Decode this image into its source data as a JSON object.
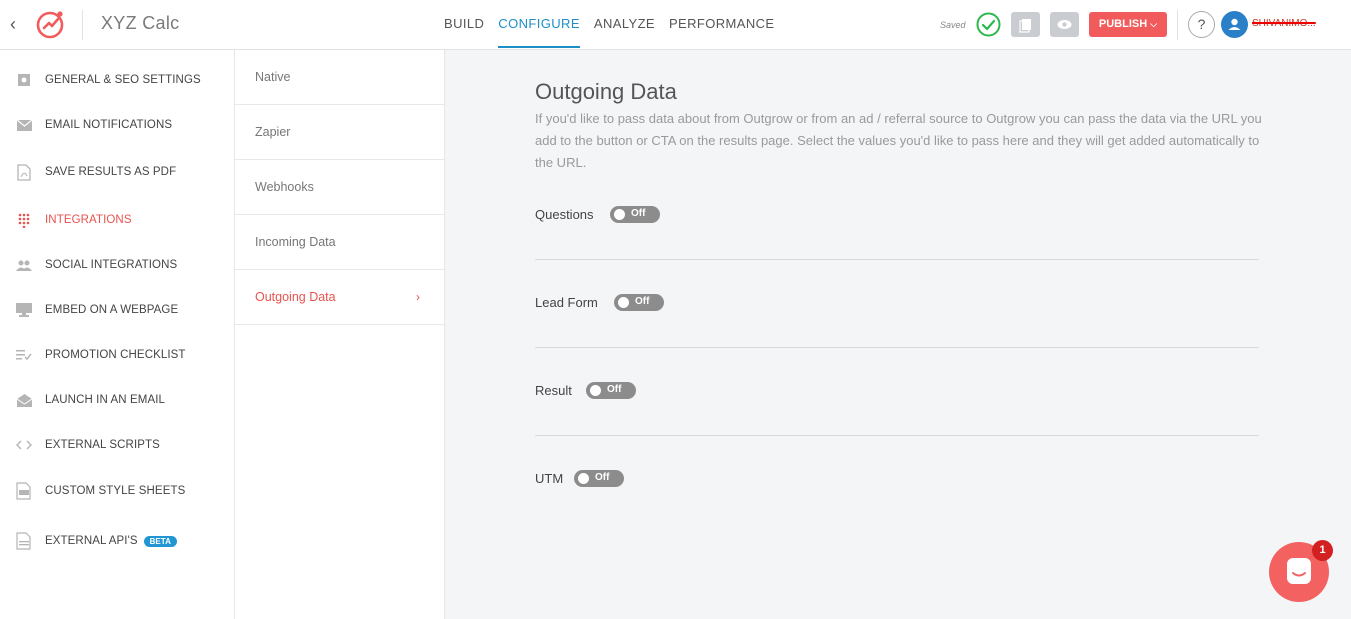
{
  "header": {
    "app_title": "XYZ Calc",
    "nav": [
      {
        "label": "BUILD"
      },
      {
        "label": "CONFIGURE",
        "active": true
      },
      {
        "label": "ANALYZE"
      },
      {
        "label": "PERFORMANCE"
      }
    ],
    "saved_label": "Saved",
    "publish_label": "PUBLISH",
    "help_label": "?",
    "username": "SHIVANIMO..."
  },
  "sidebar": {
    "items": [
      {
        "label": "GENERAL & SEO SETTINGS",
        "icon": "settings-icon"
      },
      {
        "label": "EMAIL NOTIFICATIONS",
        "icon": "envelope-icon"
      },
      {
        "label": "SAVE RESULTS AS PDF",
        "icon": "pdf-icon"
      },
      {
        "label": "INTEGRATIONS",
        "icon": "integrations-icon",
        "active": true
      },
      {
        "label": "SOCIAL INTEGRATIONS",
        "icon": "people-icon"
      },
      {
        "label": "EMBED ON A WEBPAGE",
        "icon": "monitor-icon"
      },
      {
        "label": "PROMOTION CHECKLIST",
        "icon": "checklist-icon"
      },
      {
        "label": "LAUNCH IN AN EMAIL",
        "icon": "open-envelope-icon"
      },
      {
        "label": "EXTERNAL SCRIPTS",
        "icon": "code-icon"
      },
      {
        "label": "CUSTOM STYLE SHEETS",
        "icon": "css-file-icon"
      },
      {
        "label": "EXTERNAL API'S",
        "icon": "api-file-icon",
        "badge": "BETA"
      }
    ]
  },
  "subnav": {
    "items": [
      {
        "label": "Native"
      },
      {
        "label": "Zapier"
      },
      {
        "label": "Webhooks"
      },
      {
        "label": "Incoming Data"
      },
      {
        "label": "Outgoing Data",
        "active": true,
        "chevron": "›"
      }
    ]
  },
  "main": {
    "title": "Outgoing Data",
    "description": "If you'd like to pass data about from Outgrow or from an ad / referral source to Outgrow you can pass the data via the URL you add to the button or CTA on the results page. Select the values you'd like to pass here and they will get added automatically to the URL.",
    "rows": [
      {
        "label": "Questions",
        "toggle": "Off"
      },
      {
        "label": "Lead Form",
        "toggle": "Off"
      },
      {
        "label": "Result",
        "toggle": "Off"
      },
      {
        "label": "UTM",
        "toggle": "Off"
      }
    ]
  },
  "chat": {
    "badge_count": "1"
  },
  "colors": {
    "accent_blue": "#1e8fc6",
    "accent_red": "#e8534f",
    "publish_red": "#f15b5b",
    "toggle_off": "#8c8c8c",
    "saved_green": "#2db84b"
  }
}
